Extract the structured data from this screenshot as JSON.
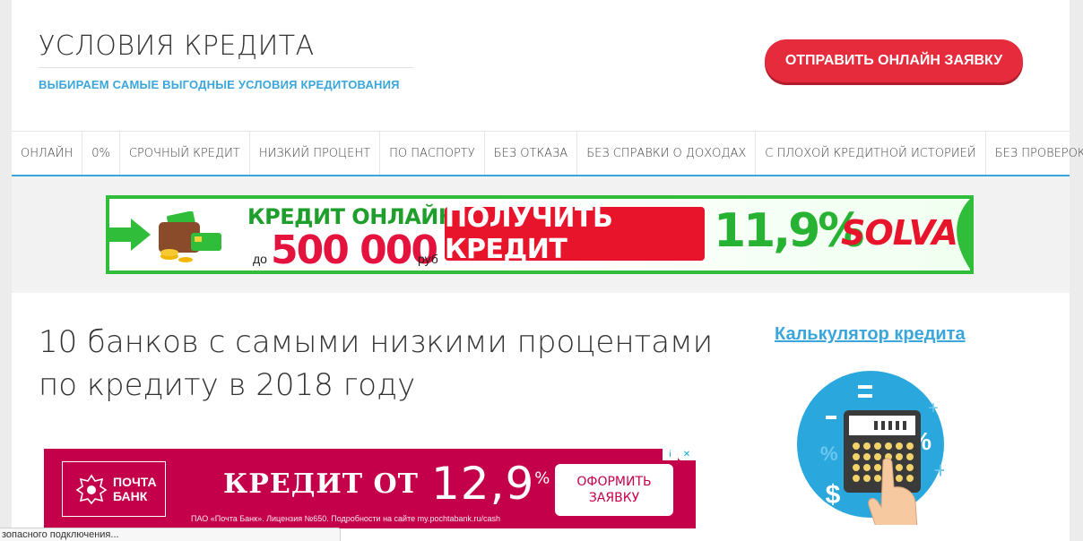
{
  "header": {
    "site_title": "УСЛОВИЯ КРЕДИТА",
    "tagline": "ВЫБИРАЕМ САМЫЕ ВЫГОДНЫЕ УСЛОВИЯ КРЕДИТОВАНИЯ",
    "cta_label": "ОТПРАВИТЬ ОНЛАЙН ЗАЯВКУ"
  },
  "nav": {
    "items": [
      "ОНЛАЙН",
      "0%",
      "СРОЧНЫЙ КРЕДИТ",
      "НИЗКИЙ ПРОЦЕНТ",
      "ПО ПАСПОРТУ",
      "БЕЗ ОТКАЗА",
      "БЕЗ СПРАВКИ О ДОХОДАХ",
      "С ПЛОХОЙ КРЕДИТНОЙ ИСТОРИЕЙ",
      "БЕЗ ПРОВЕРОК"
    ]
  },
  "top_banner": {
    "headline": "КРЕДИТ ОНЛАЙН",
    "prefix": "до",
    "amount": "500 000",
    "currency": "руб",
    "button_label": "ПОЛУЧИТЬ КРЕДИТ",
    "rate": "11,9%",
    "brand": "SOLVA"
  },
  "article": {
    "title": "10 банков с самыми низкими процентами по кредиту в 2018 году"
  },
  "ad": {
    "logo_text": "ПОЧТА БАНК",
    "headline": "КРЕДИТ ОТ",
    "rate_main": "12,9",
    "rate_sup": "%",
    "legal": "ПАО «Почта Банк». Лицензия №650. Подробности на сайте my.pochtabank.ru/cash",
    "button_label": "ОФОРМИТЬ ЗАЯВКУ",
    "choice_info": "i",
    "choice_close": "✕"
  },
  "sidebar": {
    "link_label": "Калькулятор кредита"
  },
  "status_bar": {
    "text": "зопасного подключения..."
  },
  "colors": {
    "accent": "#3aa6dc",
    "cta": "#e52b3c",
    "ad_bg": "#c5004a",
    "banner_green": "#2fbd3a"
  }
}
